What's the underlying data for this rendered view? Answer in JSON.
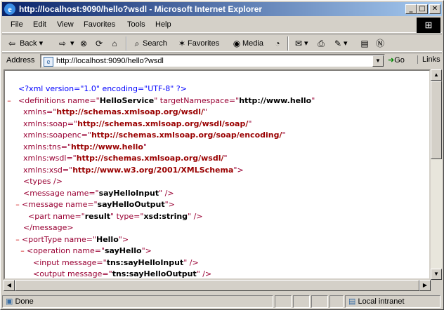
{
  "window": {
    "title": "http://localhost:9090/hello?wsdl - Microsoft Internet Explorer",
    "minimize": "_",
    "maximize": "□",
    "close": "✕"
  },
  "menu": [
    "File",
    "Edit",
    "View",
    "Favorites",
    "Tools",
    "Help"
  ],
  "toolbar": {
    "back": "Back",
    "search": "Search",
    "favorites": "Favorites",
    "media": "Media"
  },
  "address": {
    "label": "Address",
    "url": "http://localhost:9090/hello?wsdl",
    "go": "Go",
    "links": "Links"
  },
  "xml": {
    "l1_decl": "<?xml version=\"1.0\" encoding=\"UTF-8\" ?>",
    "l2_mark": "–",
    "l2_a": "<definitions name=\"",
    "l2_b": "HelloService",
    "l2_c": "\" targetNamespace=\"",
    "l2_d": "http://www.hello",
    "l2_e": "\"",
    "l3_a": "xmlns=\"",
    "l3_b": "http://schemas.xmlsoap.org/wsdl/",
    "l3_c": "\"",
    "l4_a": "xmlns:soap=\"",
    "l4_b": "http://schemas.xmlsoap.org/wsdl/soap/",
    "l4_c": "\"",
    "l5_a": "xmlns:soapenc=\"",
    "l5_b": "http://schemas.xmlsoap.org/soap/encoding/",
    "l5_c": "\"",
    "l6_a": "xmlns:tns=\"",
    "l6_b": "http://www.hello",
    "l6_c": "\"",
    "l7_a": "xmlns:wsdl=\"",
    "l7_b": "http://schemas.xmlsoap.org/wsdl/",
    "l7_c": "\"",
    "l8_a": "xmlns:xsd=\"",
    "l8_b": "http://www.w3.org/2001/XMLSchema",
    "l8_c": "\">",
    "l9": "<types />",
    "l10_a": "<message name=\"",
    "l10_b": "sayHelloInput",
    "l10_c": "\" />",
    "l11_mark": "–",
    "l11_a": "<message name=\"",
    "l11_b": "sayHelloOutput",
    "l11_c": "\">",
    "l12_a": "<part name=\"",
    "l12_b": "result",
    "l12_c": "\" type=\"",
    "l12_d": "xsd:string",
    "l12_e": "\" />",
    "l13": "</message>",
    "l14_mark": "–",
    "l14_a": "<portType name=\"",
    "l14_b": "Hello",
    "l14_c": "\">",
    "l15_mark": "–",
    "l15_a": "<operation name=\"",
    "l15_b": "sayHello",
    "l15_c": "\">",
    "l16_a": "<input message=\"",
    "l16_b": "tns:sayHelloInput",
    "l16_c": "\" />",
    "l17_a": "<output message=\"",
    "l17_b": "tns:sayHelloOutput",
    "l17_c": "\" />"
  },
  "status": {
    "text": "Done",
    "zone": "Local intranet"
  }
}
